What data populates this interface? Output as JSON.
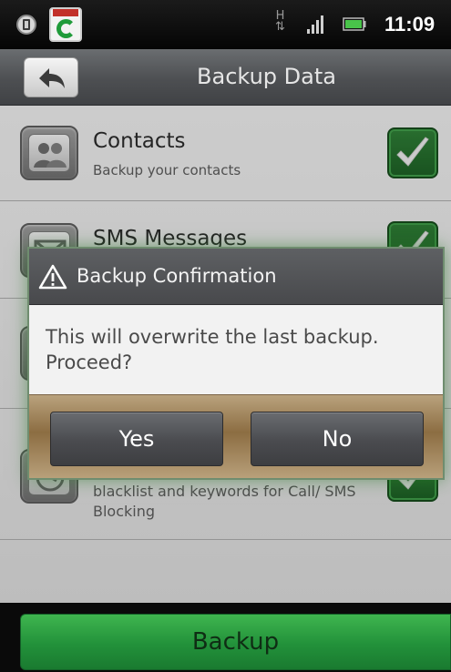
{
  "status_bar": {
    "time": "11:09",
    "network_type": "H",
    "app_badge_text": "COMODO"
  },
  "header": {
    "title": "Backup Data"
  },
  "items": [
    {
      "title": "Contacts",
      "subtitle": "Backup your contacts",
      "icon": "contacts-icon",
      "checked": true
    },
    {
      "title": "SMS Messages",
      "subtitle": "",
      "icon": "sms-icon",
      "checked": true
    },
    {
      "title": "",
      "subtitle": "",
      "icon": "call-log-icon",
      "checked": true
    },
    {
      "title": "",
      "subtitle": "Backup your contact whitelist/ blacklist and keywords for Call/ SMS Blocking",
      "icon": "blocking-icon",
      "checked": true
    }
  ],
  "dialog": {
    "title": "Backup Confirmation",
    "message": "This will overwrite the last backup. Proceed?",
    "yes_label": "Yes",
    "no_label": "No"
  },
  "footer": {
    "backup_label": "Backup"
  },
  "colors": {
    "accent_green": "#22913a",
    "header_gray": "#4d4f52",
    "check_green": "#2f7d36"
  }
}
